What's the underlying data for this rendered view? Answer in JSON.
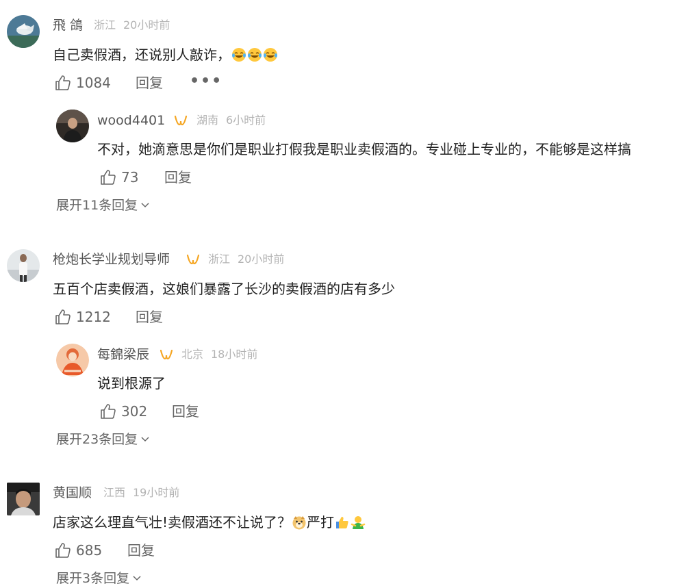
{
  "comments": [
    {
      "user": "飛 鴿",
      "location": "浙江",
      "time": "20小时前",
      "text": "自己卖假酒，还说别人敲诈，",
      "likes": "1084",
      "reply_label": "回复",
      "more_label": "•••",
      "reply": {
        "user": "wood4401",
        "location": "湖南",
        "time": "6小时前",
        "text": "不对，她滴意思是你们是职业打假我是职业卖假酒的。专业碰上专业的，不能够是这样搞",
        "likes": "73",
        "reply_label": "回复"
      },
      "expand_label": "展开11条回复"
    },
    {
      "user": "枪炮长学业规划导师",
      "location": "浙江",
      "time": "20小时前",
      "text": "五百个店卖假酒，这娘们暴露了长沙的卖假酒的店有多少",
      "likes": "1212",
      "reply_label": "回复",
      "reply": {
        "user": "每錦梁辰",
        "location": "北京",
        "time": "18小时前",
        "text": "说到根源了",
        "likes": "302",
        "reply_label": "回复"
      },
      "expand_label": "展开23条回复"
    },
    {
      "user": "黄国顺",
      "location": "江西",
      "time": "19小时前",
      "text": "店家这么理直气壮!卖假酒还不让说了？",
      "text_suffix": "严打",
      "likes": "685",
      "reply_label": "回复",
      "expand_label": "展开3条回复"
    }
  ],
  "colors": {
    "badge": "#f5a623",
    "meta": "#b3b3b3",
    "action": "#666666"
  }
}
